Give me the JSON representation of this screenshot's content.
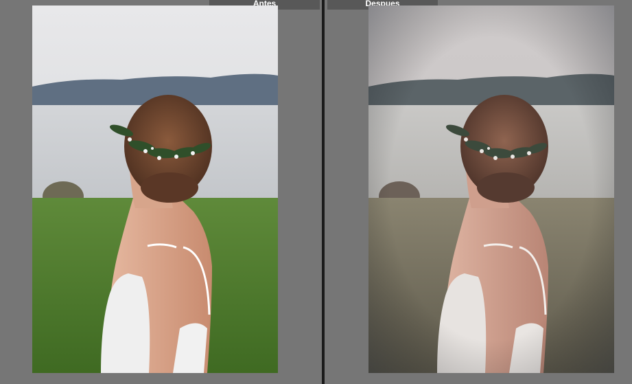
{
  "compare_view": {
    "before_label": "Antes",
    "after_label": "Despues"
  },
  "photos": {
    "before": {
      "subject": "bride-back-view",
      "tone": "natural"
    },
    "after": {
      "subject": "bride-back-view",
      "tone": "faded-matte"
    }
  },
  "colors": {
    "background": "#767676",
    "divider": "#1b1b1b",
    "label_background": "#585858",
    "label_text": "#ffffff"
  }
}
